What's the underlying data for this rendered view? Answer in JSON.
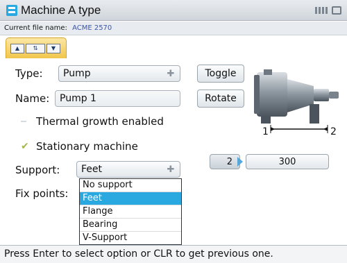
{
  "window": {
    "title": "Machine A type",
    "app_icon": "grid-app-icon"
  },
  "filebar": {
    "label": "Current file name:",
    "value": "ACME 2570"
  },
  "toolbar": {
    "btn1": "▲",
    "btn2": "⇅",
    "btn3": "▼"
  },
  "form": {
    "type_label": "Type:",
    "type_value": "Pump",
    "name_label": "Name:",
    "name_value": "Pump 1",
    "thermal_label": "Thermal growth enabled",
    "stationary_label": "Stationary machine",
    "stationary_check": "✔",
    "support_label": "Support:",
    "support_value": "Feet",
    "fixpoints_label": "Fix points:"
  },
  "buttons": {
    "toggle": "Toggle",
    "rotate": "Rotate"
  },
  "stepper": {
    "number": "2",
    "value": "300"
  },
  "dropdown": {
    "options": [
      "No support",
      "Feet",
      "Flange",
      "Bearing",
      "V-Support"
    ],
    "selected": "Feet"
  },
  "figure": {
    "label_1": "1",
    "label_2": "2"
  },
  "statusbar": {
    "text": "Press Enter to select option or CLR to get previous one."
  },
  "colors": {
    "accent": "#2aa9e0",
    "toolbar": "#f1c64a"
  }
}
